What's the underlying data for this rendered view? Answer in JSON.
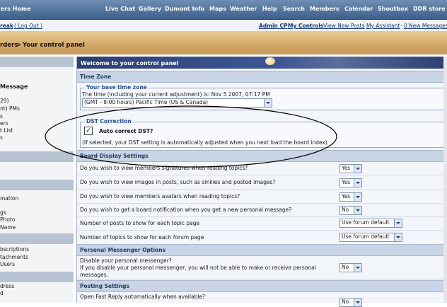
{
  "topnav": {
    "items": [
      "lers Home",
      "Live Chat",
      "Gallery",
      "Dumont Info",
      "Maps",
      "Weather",
      "Help",
      "Search",
      "Members",
      "Calendar",
      "Shoutbox",
      "DDR store"
    ]
  },
  "userbar": {
    "user_fragment": "reak",
    "logout_label": "( Log Out )",
    "links": [
      "Admin CP",
      "My Controls",
      "View New Posts",
      "My Assistant",
      "0 New Messages"
    ],
    "separator": "·"
  },
  "breadcrumb": {
    "parent": "rders",
    "separator": ">",
    "current": "Your control panel"
  },
  "sidebar": {
    "items": [
      "Message",
      "29)",
      "nt) PMs",
      "s",
      "ers",
      "t List",
      "s",
      "mation",
      "gs",
      "Photo",
      "Name",
      "bscriptions",
      "tachments",
      "Users",
      "dress",
      "d"
    ]
  },
  "main": {
    "welcome_title": "Welcome to your control panel",
    "timezone": {
      "section_title": "Time Zone",
      "legend": "Your base time zone",
      "current_time_text": "The time (including your current adjustment) is: Nov 5 2007, 07:17 PM",
      "select_value": "(GMT - 8:00 hours) Pacific Time (US & Canada)"
    },
    "dst": {
      "legend": "DST Correction",
      "checkbox_label": "Auto correct DST?",
      "checked": true,
      "note": "(If selected, your DST setting is automatically adjusted when you next load the board index)"
    },
    "board_display": {
      "section_title": "Board Display Settings",
      "rows": [
        {
          "label": "Do you wish to view members signatures when reading topics?",
          "value": "Yes"
        },
        {
          "label": "Do you wish to view images in posts, such as smilies and posted images?",
          "value": "Yes"
        },
        {
          "label": "Do you wish to view members avatars when reading topics?",
          "value": "Yes"
        },
        {
          "label": "Do you wish to get a board notification when you get a new personal message?",
          "value": "No"
        },
        {
          "label": "Number of posts to show for each topic page",
          "value": "Use forum default"
        },
        {
          "label": "Number of topics to show for each forum page",
          "value": "Use forum default"
        }
      ]
    },
    "messenger": {
      "section_title": "Personal Messenger Options",
      "label_line1": "Disable your personal messenger?",
      "label_line2": "If you disable your personal messenger, you will not be able to make or receive personal",
      "label_line3": "messages.",
      "value": "No"
    },
    "posting": {
      "section_title": "Posting Settings",
      "fast_reply_label": "Open Fast Reply automatically when available?",
      "fast_reply_value": "No"
    }
  },
  "colors": {
    "nav_bar": "#3d5f8c",
    "section_header": "#c9d5e6",
    "legend_text": "#2a4ea0",
    "annotation_circle": "#000000"
  }
}
